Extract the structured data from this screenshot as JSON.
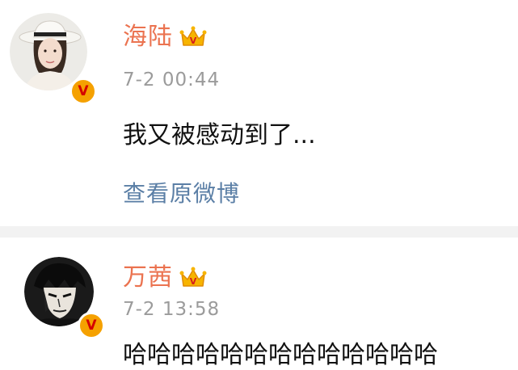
{
  "colors": {
    "username": "#eb7350",
    "timestamp": "#9b9b9b",
    "link": "#5b7fa6",
    "badge_bg": "#f5a100",
    "badge_fg": "#d40000",
    "separator": "#f2f2f2"
  },
  "posts": [
    {
      "username": "海陆",
      "timestamp": "7-2 00:44",
      "content": "我又被感动到了...",
      "link_label": "查看原微博",
      "badge_letter": "V",
      "badge_icon": "crown-vip-icon",
      "verified_icon": "verified-v-badge-icon"
    },
    {
      "username": "万茜",
      "timestamp": "7-2 13:58",
      "content": "哈哈哈哈哈哈哈哈哈哈哈哈哈",
      "badge_letter": "V",
      "badge_icon": "crown-vip-icon",
      "verified_icon": "verified-v-badge-icon"
    }
  ]
}
